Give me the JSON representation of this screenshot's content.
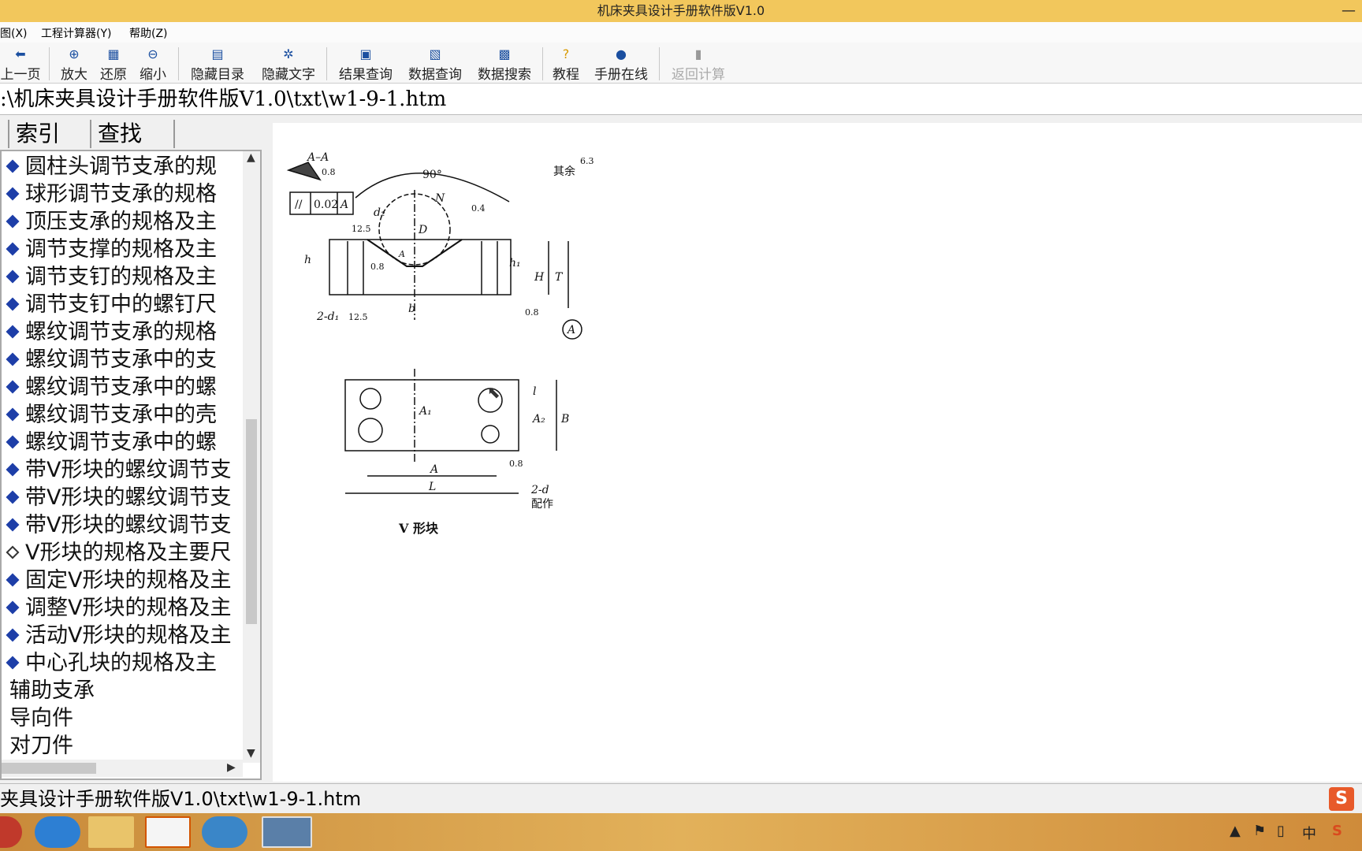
{
  "window": {
    "title": "机床夹具设计手册软件版V1.0",
    "minimize": "—"
  },
  "menu": {
    "items": [
      "图(X)",
      "工程计算器(Y)",
      "帮助(Z)"
    ]
  },
  "toolbar": {
    "buttons": [
      {
        "label": "上一页",
        "icon": "back-arrow-icon"
      },
      {
        "label": "放大",
        "icon": "zoom-in-icon"
      },
      {
        "label": "还原",
        "icon": "restore-icon"
      },
      {
        "label": "缩小",
        "icon": "zoom-out-icon"
      },
      {
        "label": "隐藏目录",
        "icon": "hide-toc-icon"
      },
      {
        "label": "隐藏文字",
        "icon": "hide-text-icon"
      },
      {
        "label": "结果查询",
        "icon": "result-query-icon"
      },
      {
        "label": "数据查询",
        "icon": "data-query-icon"
      },
      {
        "label": "数据搜索",
        "icon": "data-search-icon"
      },
      {
        "label": "教程",
        "icon": "help-icon"
      },
      {
        "label": "手册在线",
        "icon": "globe-icon"
      },
      {
        "label": "返回计算",
        "icon": "return-calc-icon"
      }
    ]
  },
  "path": ":\\机床夹具设计手册软件版V1.0\\txt\\w1-9-1.htm",
  "tabs": {
    "index": "索引",
    "search": "查找"
  },
  "tree": {
    "items": [
      "圆柱头调节支承的规",
      "球形调节支承的规格",
      "顶压支承的规格及主",
      "调节支撑的规格及主",
      "调节支钉的规格及主",
      "调节支钉中的螺钉尺",
      "螺纹调节支承的规格",
      "螺纹调节支承中的支",
      "螺纹调节支承中的螺",
      "螺纹调节支承中的壳",
      "螺纹调节支承中的螺",
      "带V形块的螺纹调节支",
      "带V形块的螺纹调节支",
      "带V形块的螺纹调节支",
      "V形块的规格及主要尺",
      "固定V形块的规格及主",
      "调整V形块的规格及主",
      "活动V形块的规格及主",
      "中心孔块的规格及主"
    ],
    "groups": [
      "辅助支承",
      "导向件",
      "对刀件"
    ]
  },
  "drawing": {
    "section": "A–A",
    "angle": "90°",
    "rest": "其余",
    "rest_value": "6.3",
    "tolerance": [
      "//",
      "0.02",
      "A"
    ],
    "labels": {
      "N": "N",
      "d2": "d₂",
      "D": "D",
      "h": "h",
      "h1": "h₁",
      "H": "H",
      "T": "T",
      "b": "b",
      "twod1": "2-d₁",
      "r125a": "12.5",
      "r125b": "12.5",
      "r08": "0.8",
      "r04": "0.4",
      "r08b": "0.8",
      "datum": "A",
      "l": "l",
      "A1": "A₁",
      "A2": "A₂",
      "B": "B",
      "A": "A",
      "L": "L",
      "twod": "2-d",
      "peizuo": "配作",
      "r08c": "0.8",
      "hA": "A",
      "r08d": "0.8"
    },
    "caption": "V 形块"
  },
  "status": "夹具设计手册软件版V1.0\\txt\\w1-9-1.htm",
  "ime": "S",
  "tray": {
    "lang": "中"
  }
}
